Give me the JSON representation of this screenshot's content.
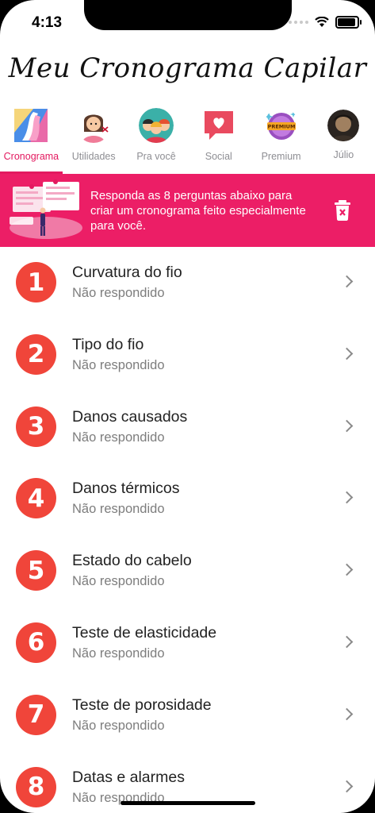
{
  "status_bar": {
    "time": "4:13"
  },
  "app": {
    "title": "Meu Cronograma Capilar"
  },
  "tabs": [
    {
      "label": "Cronograma",
      "icon": "cronograma-icon",
      "active": true
    },
    {
      "label": "Utilidades",
      "icon": "woman-scissors-icon",
      "active": false
    },
    {
      "label": "Pra você",
      "icon": "people-group-icon",
      "active": false
    },
    {
      "label": "Social",
      "icon": "chat-heart-icon",
      "active": false
    },
    {
      "label": "Premium",
      "icon": "premium-badge-icon",
      "active": false
    },
    {
      "label": "Júlio",
      "icon": "avatar",
      "active": false
    }
  ],
  "banner": {
    "text": "Responda as 8 perguntas abaixo para criar um cronograma feito especialmente para você.",
    "background": "#ec1e66"
  },
  "questions": [
    {
      "number": "1",
      "title": "Curvatura do fio",
      "status": "Não respondido"
    },
    {
      "number": "2",
      "title": "Tipo do fio",
      "status": "Não respondido"
    },
    {
      "number": "3",
      "title": "Danos causados",
      "status": "Não respondido"
    },
    {
      "number": "4",
      "title": "Danos térmicos",
      "status": "Não respondido"
    },
    {
      "number": "5",
      "title": "Estado do cabelo",
      "status": "Não respondido"
    },
    {
      "number": "6",
      "title": "Teste de elasticidade",
      "status": "Não respondido"
    },
    {
      "number": "7",
      "title": "Teste de porosidade",
      "status": "Não respondido"
    },
    {
      "number": "8",
      "title": "Datas e alarmes",
      "status": "Não respondido"
    }
  ],
  "colors": {
    "accent": "#e3195f",
    "number_circle": "#f0453a"
  }
}
